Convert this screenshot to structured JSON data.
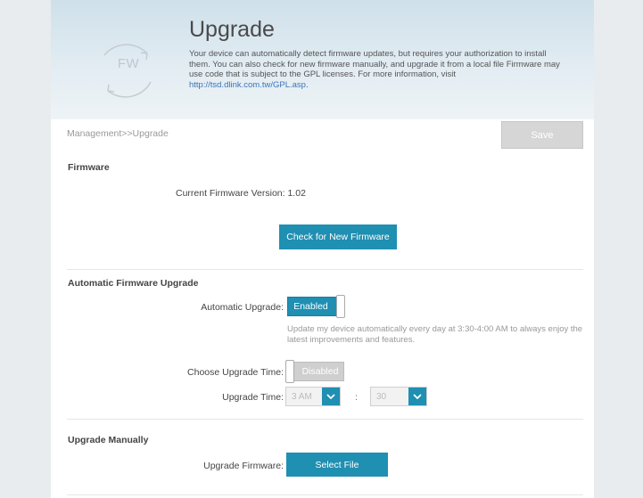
{
  "header": {
    "title": "Upgrade",
    "icon_text": "FW",
    "description": "Your device can automatically detect firmware updates, but requires your authorization to install them. You can also check for new firmware manually, and upgrade it from a local file Firmware may use code that is subject to the GPL licenses. For more information, visit ",
    "link": "http://tsd.dlink.com.tw/GPL.asp",
    "link_suffix": "."
  },
  "breadcrumb": "Management>>Upgrade",
  "save_label": "Save",
  "firmware": {
    "section_title": "Firmware",
    "current_version_label": "Current Firmware Version:",
    "current_version": "1.02",
    "check_button": "Check for New Firmware"
  },
  "auto_upgrade": {
    "section_title": "Automatic Firmware Upgrade",
    "auto_label": "Automatic Upgrade:",
    "auto_state": "Enabled",
    "description": "Update my device automatically every day at 3:30-4:00 AM to always enjoy the latest improvements and features.",
    "choose_label": "Choose Upgrade Time:",
    "choose_state": "Disabled",
    "time_label": "Upgrade Time:",
    "hour": "3 AM",
    "separator": ":",
    "minute": "30"
  },
  "manual": {
    "section_title": "Upgrade Manually",
    "firmware_label": "Upgrade Firmware:",
    "select_button": "Select File"
  },
  "colors": {
    "accent": "#1f8fb2",
    "disabled": "#cfcfcf",
    "link": "#3b73b9"
  }
}
